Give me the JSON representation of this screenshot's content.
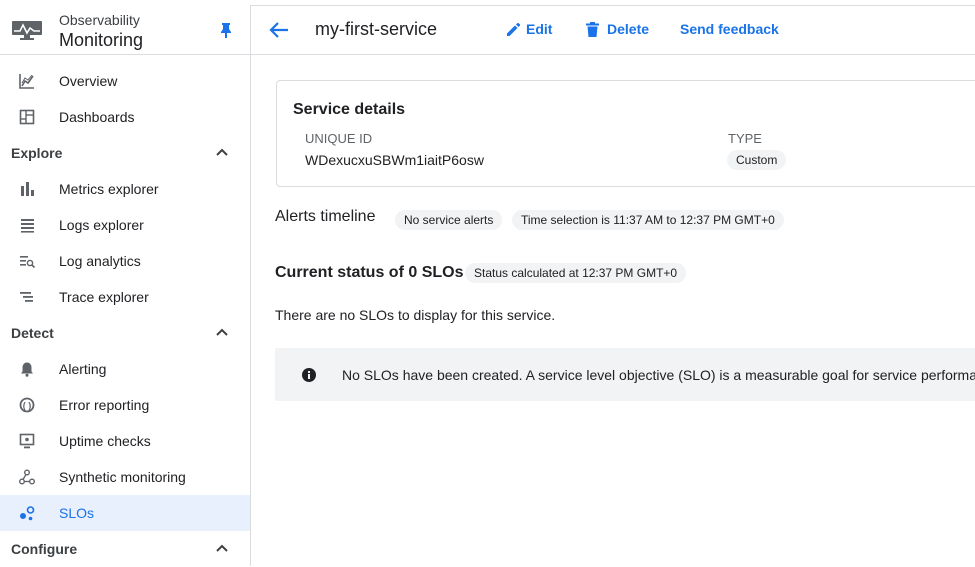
{
  "app": {
    "subtitle": "Observability",
    "title": "Monitoring"
  },
  "sidebar": {
    "top_items": [
      {
        "label": "Overview",
        "icon": "overview-icon"
      },
      {
        "label": "Dashboards",
        "icon": "dashboards-icon"
      }
    ],
    "sections": [
      {
        "label": "Explore",
        "expanded": true,
        "items": [
          {
            "label": "Metrics explorer",
            "icon": "bar-chart-icon"
          },
          {
            "label": "Logs explorer",
            "icon": "list-icon"
          },
          {
            "label": "Log analytics",
            "icon": "search-list-icon"
          },
          {
            "label": "Trace explorer",
            "icon": "trace-icon"
          }
        ]
      },
      {
        "label": "Detect",
        "expanded": true,
        "items": [
          {
            "label": "Alerting",
            "icon": "bell-icon"
          },
          {
            "label": "Error reporting",
            "icon": "error-reporting-icon"
          },
          {
            "label": "Uptime checks",
            "icon": "monitor-icon"
          },
          {
            "label": "Synthetic monitoring",
            "icon": "synthetic-icon"
          },
          {
            "label": "SLOs",
            "icon": "slo-icon",
            "active": true
          }
        ]
      },
      {
        "label": "Configure",
        "expanded": true,
        "items": []
      }
    ]
  },
  "header": {
    "title": "my-first-service",
    "edit_label": "Edit",
    "delete_label": "Delete",
    "feedback_label": "Send feedback"
  },
  "service_details": {
    "title": "Service details",
    "unique_id_label": "UNIQUE ID",
    "unique_id_value": "WDexucxuSBWm1iaitP6osw",
    "type_label": "TYPE",
    "type_value": "Custom"
  },
  "alerts": {
    "title": "Alerts timeline",
    "status_chip": "No service alerts",
    "time_chip": "Time selection is 11:37 AM to 12:37 PM GMT+0"
  },
  "slo_status": {
    "title": "Current status of 0 SLOs",
    "calc_chip": "Status calculated at 12:37 PM GMT+0",
    "empty_message": "There are no SLOs to display for this service.",
    "info_banner": "No SLOs have been created. A service level objective (SLO) is a measurable goal for service performance"
  },
  "colors": {
    "accent": "#1a73e8",
    "active_bg": "#e8f0fe",
    "chip_bg": "#f1f3f4",
    "border": "#dadce0"
  }
}
